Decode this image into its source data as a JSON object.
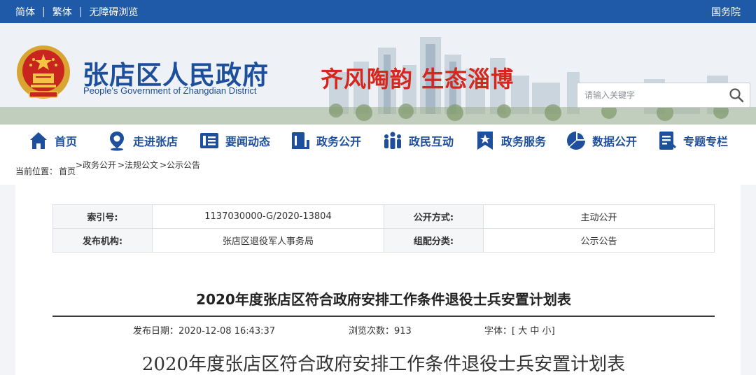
{
  "topbar": {
    "links": [
      "简体",
      "繁体",
      "无障碍浏览"
    ],
    "right_link": "国务院"
  },
  "header": {
    "title": "张店区人民政府",
    "subtitle": "People's Government of Zhangdian District",
    "slogan": "齐风陶韵 生态淄博",
    "search_placeholder": "请输入关键字"
  },
  "nav": {
    "items": [
      {
        "label": "首页",
        "icon": "home-icon"
      },
      {
        "label": "走进张店",
        "icon": "location-pin-icon"
      },
      {
        "label": "要闻动态",
        "icon": "news-icon"
      },
      {
        "label": "政务公开",
        "icon": "document-icon"
      },
      {
        "label": "政民互动",
        "icon": "people-icon"
      },
      {
        "label": "政务服务",
        "icon": "star-bookmark-icon"
      },
      {
        "label": "数据公开",
        "icon": "pie-chart-icon"
      },
      {
        "label": "专题专栏",
        "icon": "notepad-icon"
      }
    ],
    "color": "#1d4f9c"
  },
  "breadcrumb": {
    "prefix": "当前位置：",
    "items": [
      "首页",
      ">政务公开",
      ">法规公文",
      ">公示公告"
    ]
  },
  "meta": {
    "index_label": "索引号:",
    "index_value": "1137030000-G/2020-13804",
    "mode_label": "公开方式:",
    "mode_value": "主动公开",
    "org_label": "发布机构:",
    "org_value": "张店区退役军人事务局",
    "category_label": "组配分类:",
    "category_value": "公示公告"
  },
  "article": {
    "title": "2020年度张店区符合政府安排工作条件退役士兵安置计划表",
    "date_label": "发布日期：",
    "date_value": "2020-12-08 16:43:37",
    "views_label": "浏览次数：",
    "views_value": "913",
    "font_label": "字体：",
    "font_open": "[",
    "font_large": "大",
    "font_medium": "中",
    "font_small": "小",
    "font_close": "]",
    "body_title": "2020年度张店区符合政府安排工作条件退役士兵安置计划表"
  },
  "colors": {
    "topbar": "#1e5aa8",
    "brand_blue": "#1d4f9c",
    "slogan_red": "#d5271e"
  }
}
